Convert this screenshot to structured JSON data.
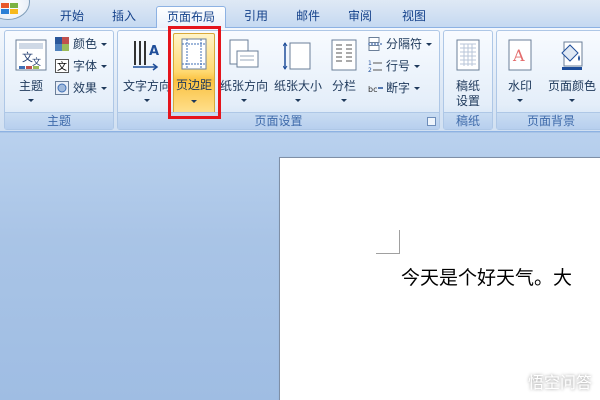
{
  "tabs": [
    {
      "label": "开始"
    },
    {
      "label": "插入"
    },
    {
      "label": "页面布局"
    },
    {
      "label": "引用"
    },
    {
      "label": "邮件"
    },
    {
      "label": "审阅"
    },
    {
      "label": "视图"
    }
  ],
  "active_tab": "页面布局",
  "ribbon": {
    "theme_group": {
      "label": "主题",
      "theme_button": "主题",
      "colors": "颜色",
      "fonts": "字体",
      "effects": "效果"
    },
    "page_setup_group": {
      "label": "页面设置",
      "text_direction": "文字方向",
      "margins": "页边距",
      "orientation": "纸张方向",
      "size": "纸张大小",
      "columns": "分栏",
      "breaks": "分隔符",
      "line_numbers": "行号",
      "hyphenation": "断字"
    },
    "draft_group": {
      "label": "稿纸",
      "draft_settings_line1": "稿纸",
      "draft_settings_line2": "设置"
    },
    "page_background_group": {
      "label": "页面背景",
      "watermark": "水印",
      "page_color": "页面颜色"
    }
  },
  "document": {
    "text": "今天是个好天气。大"
  },
  "site_watermark": "悟空问答",
  "colors": {
    "highlight_border": "#e5141b",
    "active_button": "#fbc141",
    "page": "#ffffff",
    "workspace": "#a9c4e6"
  }
}
